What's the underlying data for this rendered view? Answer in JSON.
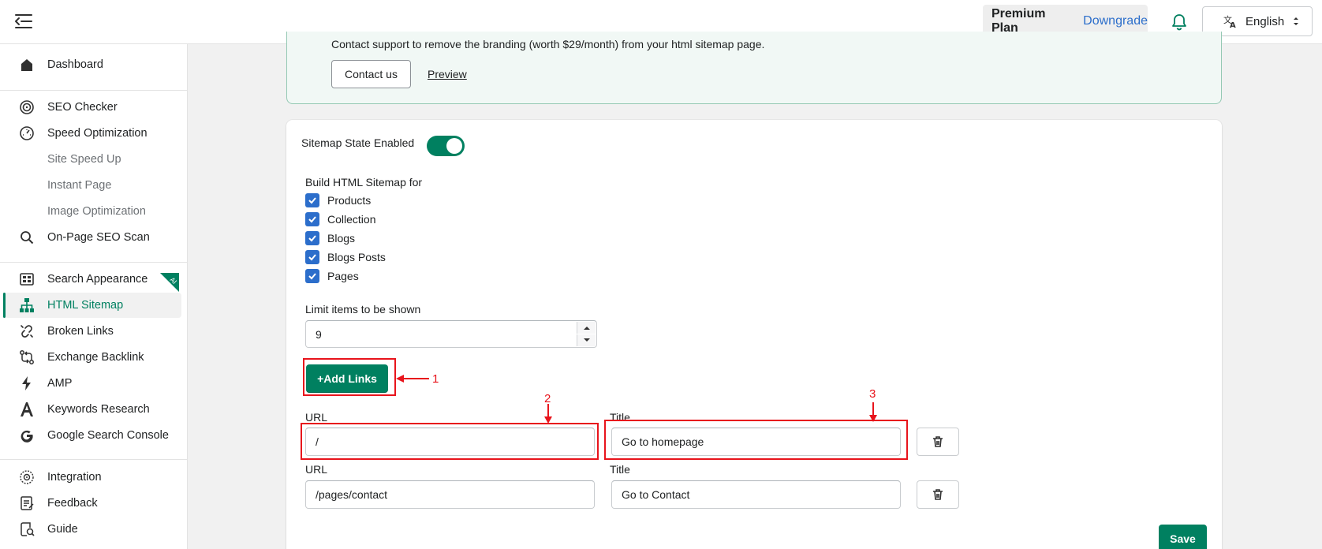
{
  "header": {
    "plan_name": "Premium Plan",
    "plan_action": "Downgrade",
    "language": "English"
  },
  "sidebar": {
    "items": [
      {
        "label": "Dashboard"
      },
      {
        "label": "SEO Checker"
      },
      {
        "label": "Speed Optimization"
      },
      {
        "label": "Site Speed Up"
      },
      {
        "label": "Instant Page"
      },
      {
        "label": "Image Optimization"
      },
      {
        "label": "On-Page SEO Scan"
      },
      {
        "label": "Search Appearance"
      },
      {
        "label": "HTML Sitemap"
      },
      {
        "label": "Broken Links"
      },
      {
        "label": "Exchange Backlink"
      },
      {
        "label": "AMP"
      },
      {
        "label": "Keywords Research"
      },
      {
        "label": "Google Search Console"
      },
      {
        "label": "Integration"
      },
      {
        "label": "Feedback"
      },
      {
        "label": "Guide"
      }
    ],
    "ai_badge": "AI",
    "active_item": "HTML Sitemap",
    "accent_color": "#008060"
  },
  "banner": {
    "text": "Contact support to remove the branding (worth $29/month) from your html sitemap page.",
    "contact_label": "Contact us",
    "preview_label": "Preview"
  },
  "form": {
    "state_label": "Sitemap State Enabled",
    "state_enabled": true,
    "build_label": "Build HTML Sitemap for",
    "options": [
      {
        "label": "Products",
        "checked": true
      },
      {
        "label": "Collection",
        "checked": true
      },
      {
        "label": "Blogs",
        "checked": true
      },
      {
        "label": "Blogs Posts",
        "checked": true
      },
      {
        "label": "Pages",
        "checked": true
      }
    ],
    "limit_label": "Limit items to be shown",
    "limit_value": "9",
    "add_links_label": "+Add Links",
    "url_label": "URL",
    "title_label": "Title",
    "links": [
      {
        "url": "/",
        "title": "Go to homepage"
      },
      {
        "url": "/pages/contact",
        "title": "Go to Contact"
      }
    ],
    "save_label": "Save"
  },
  "annotations": [
    "1",
    "2",
    "3"
  ]
}
